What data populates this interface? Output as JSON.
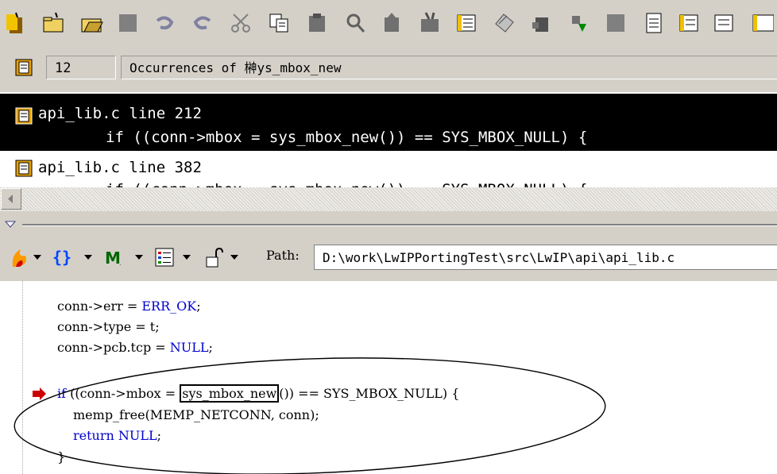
{
  "toolbar": {
    "icons": [
      "open-project-icon",
      "new-folder-icon",
      "open-file-icon",
      "save-icon",
      "undo-icon",
      "redo-icon",
      "cut-icon",
      "copy-icon",
      "paste-icon",
      "search-icon",
      "lookup-icon",
      "jump-icon",
      "list-icon",
      "relation-icon",
      "back-icon",
      "forward-icon",
      "bookmark-icon",
      "document-icon",
      "more-icon"
    ]
  },
  "search": {
    "count": "12",
    "occurrences": "Occurrences of 榊ys_mbox_new"
  },
  "results": [
    {
      "file": "api_lib.c line 212",
      "code": "if ((conn->mbox = sys_mbox_new()) == SYS_MBOX_NULL) {"
    },
    {
      "file": "api_lib.c line 382",
      "code": "if ((conn->mbox = sys_mbox_new()) == SYS_MBOX_NULL) {"
    }
  ],
  "pathbar": {
    "path_label": "Path:",
    "path_value": "D:\\work\\LwIPPortingTest\\src\\LwIP\\api\\api_lib.c"
  },
  "code": {
    "l1": "conn->err = ",
    "l1_val": "ERR_OK",
    "l1_end": ";",
    "l2": "conn->type = t;",
    "l3": "conn->pcb.tcp = ",
    "l3_val": "NULL",
    "l3_end": ";",
    "l4_kw": "if",
    "l4_a": " ((conn->mbox = ",
    "l4_hl": "sys_mbox_new",
    "l4_b": "()) == SYS_MBOX_NULL) {",
    "l5": "memp_free(MEMP_NETCONN, conn);",
    "l6_kw": "return",
    "l6_val": "NULL",
    "l6_end": ";",
    "l7": "}"
  },
  "colors": {
    "toolbar_bg": "#d4d0c8",
    "selection": "#000000",
    "keyword": "#0000cc",
    "breakpoint": "#cc0000"
  }
}
